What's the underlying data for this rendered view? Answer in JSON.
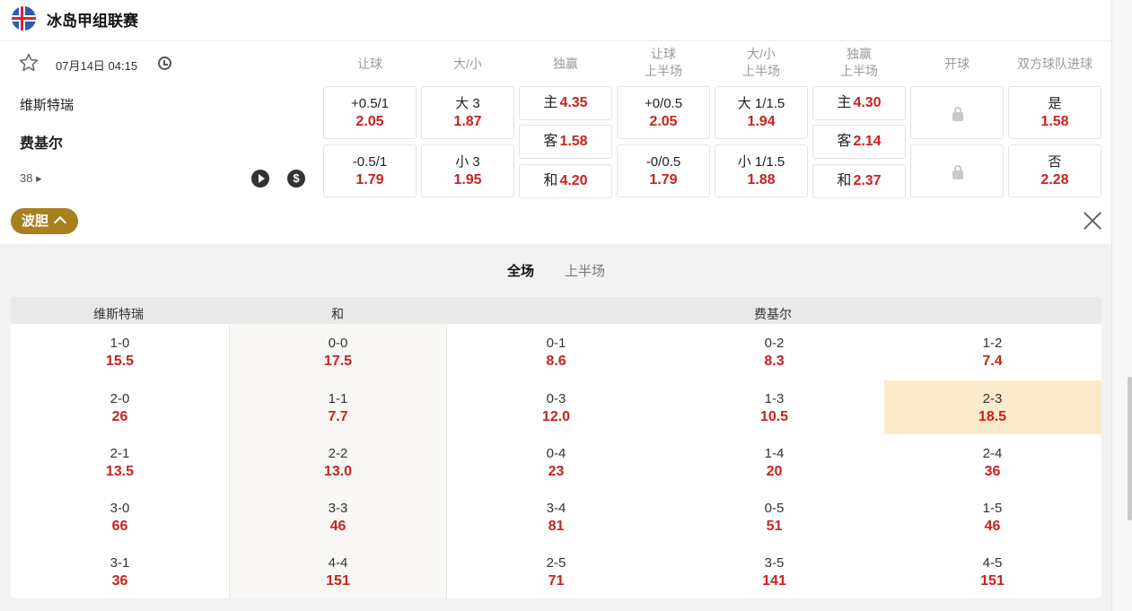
{
  "league": {
    "title": "冰岛甲组联赛",
    "flag": "iceland-flag"
  },
  "match": {
    "datetime": "07月14日 04:15",
    "home": "维斯特瑞",
    "away": "费基尔",
    "more": "38",
    "more_arrow": "▸"
  },
  "columns": [
    "让球",
    "大/小",
    "独赢",
    "让球\n上半场",
    "大/小\n上半场",
    "独赢\n上半场",
    "开球",
    "双方球队进球"
  ],
  "odds": {
    "handicap": [
      {
        "label": "+0.5/1",
        "odd": "2.05"
      },
      {
        "label": "-0.5/1",
        "odd": "1.79"
      }
    ],
    "total": [
      {
        "label": "大 3",
        "odd": "1.87"
      },
      {
        "label": "小 3",
        "odd": "1.95"
      }
    ],
    "moneyline": [
      {
        "label": "主",
        "odd": "4.35"
      },
      {
        "label": "客",
        "odd": "1.58"
      },
      {
        "label": "和",
        "odd": "4.20"
      }
    ],
    "handicap_half": [
      {
        "label": "+0/0.5",
        "odd": "2.05"
      },
      {
        "label": "-0/0.5",
        "odd": "1.79"
      }
    ],
    "total_half": [
      {
        "label": "大 1/1.5",
        "odd": "1.94"
      },
      {
        "label": "小 1/1.5",
        "odd": "1.88"
      }
    ],
    "moneyline_half": [
      {
        "label": "主",
        "odd": "4.30"
      },
      {
        "label": "客",
        "odd": "2.14"
      },
      {
        "label": "和",
        "odd": "2.37"
      }
    ],
    "btts": [
      {
        "label": "是",
        "odd": "1.58"
      },
      {
        "label": "否",
        "odd": "2.28"
      }
    ]
  },
  "correct_score": {
    "toggle_label": "波胆",
    "tabs": [
      "全场",
      "上半场"
    ],
    "headers": {
      "home": "维斯特瑞",
      "draw": "和",
      "away": "费基尔"
    },
    "home": [
      [
        "1-0",
        "15.5"
      ],
      [
        "2-0",
        "26"
      ],
      [
        "2-1",
        "13.5"
      ],
      [
        "3-0",
        "66"
      ],
      [
        "3-1",
        "36"
      ]
    ],
    "draw": [
      [
        "0-0",
        "17.5"
      ],
      [
        "1-1",
        "7.7"
      ],
      [
        "2-2",
        "13.0"
      ],
      [
        "3-3",
        "46"
      ],
      [
        "4-4",
        "151"
      ]
    ],
    "away_a": [
      [
        "0-1",
        "8.6"
      ],
      [
        "0-3",
        "12.0"
      ],
      [
        "0-4",
        "23"
      ],
      [
        "3-4",
        "81"
      ],
      [
        "2-5",
        "71"
      ]
    ],
    "away_b": [
      [
        "0-2",
        "8.3"
      ],
      [
        "1-3",
        "10.5"
      ],
      [
        "1-4",
        "20"
      ],
      [
        "0-5",
        "51"
      ],
      [
        "3-5",
        "141"
      ]
    ],
    "away_c": [
      [
        "1-2",
        "7.4"
      ],
      [
        "2-3",
        "18.5"
      ],
      [
        "2-4",
        "36"
      ],
      [
        "1-5",
        "46"
      ],
      [
        "4-5",
        "151"
      ]
    ],
    "highlight_color": "#faeacb",
    "accent_color": "#c8231f"
  }
}
